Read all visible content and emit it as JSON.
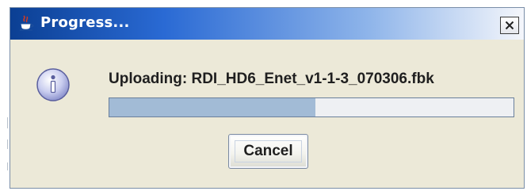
{
  "window": {
    "title": "Progress..."
  },
  "dialog": {
    "message": "Uploading: RDI_HD6_Enet_v1-1-3_070306.fbk",
    "progress_fraction": 0.51,
    "cancel_label": "Cancel"
  },
  "icons": {
    "titlebar": "java-icon",
    "close": "close-icon",
    "message": "info-icon"
  },
  "colors": {
    "titlebar_start": "#0b3f93",
    "titlebar_end": "#f4f6fb",
    "progress_fill": "#a2bbd6",
    "dialog_background": "#ece9d8"
  }
}
